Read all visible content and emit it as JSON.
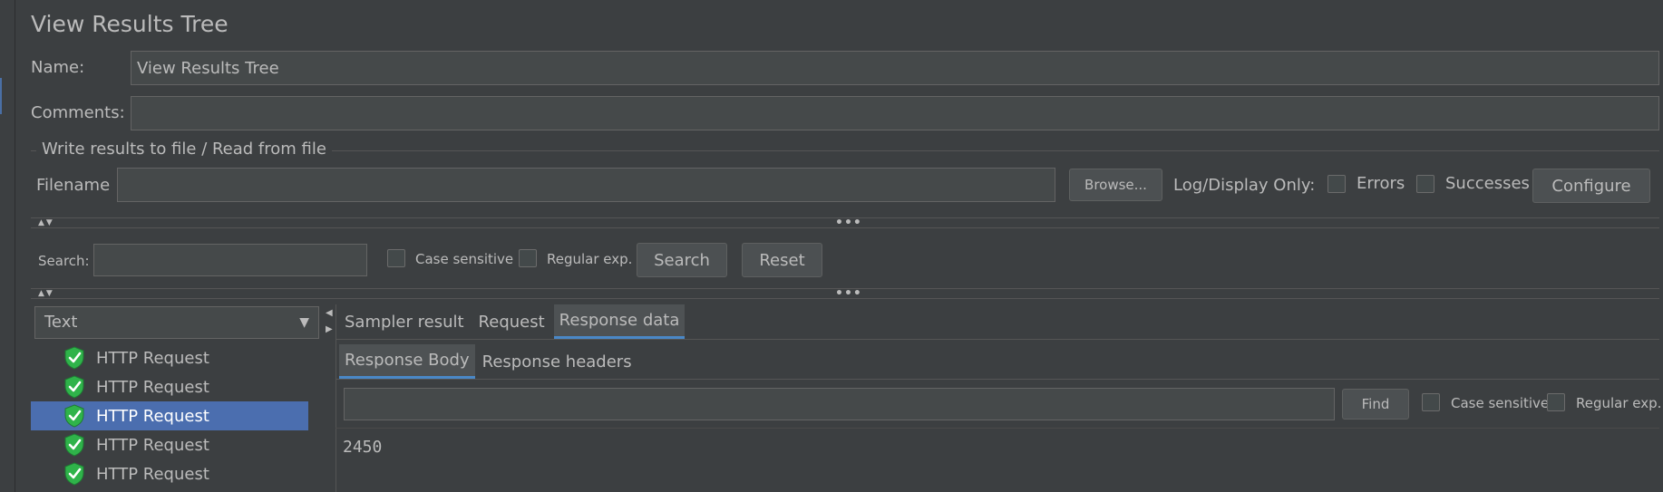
{
  "panel_title": "View Results Tree",
  "name_label": "Name:",
  "name_value": "View Results Tree",
  "comments_label": "Comments:",
  "comments_value": "",
  "file_section": {
    "legend": "Write results to file / Read from file",
    "filename_label": "Filename",
    "filename_value": "",
    "browse_label": "Browse...",
    "log_display_label": "Log/Display Only:",
    "errors_label": "Errors",
    "successes_label": "Successes",
    "configure_label": "Configure"
  },
  "search_bar": {
    "search_label": "Search:",
    "search_value": "",
    "case_sensitive_label": "Case sensitive",
    "regex_label": "Regular exp.",
    "search_button": "Search",
    "reset_button": "Reset"
  },
  "renderer_select": {
    "selected": "Text"
  },
  "tree": {
    "items": [
      {
        "label": "HTTP Request",
        "status": "success",
        "selected": false
      },
      {
        "label": "HTTP Request",
        "status": "success",
        "selected": false
      },
      {
        "label": "HTTP Request",
        "status": "success",
        "selected": true
      },
      {
        "label": "HTTP Request",
        "status": "success",
        "selected": false
      },
      {
        "label": "HTTP Request",
        "status": "success",
        "selected": false
      }
    ]
  },
  "result_tabs": [
    "Sampler result",
    "Request",
    "Response data"
  ],
  "active_result_tab": "Response data",
  "response_tabs": [
    "Response Body",
    "Response headers"
  ],
  "active_response_tab": "Response Body",
  "find_bar": {
    "find_value": "",
    "find_button": "Find",
    "case_sensitive_label": "Case sensitive",
    "regex_label": "Regular exp."
  },
  "response_body": "2450",
  "colors": {
    "background": "#3c3f41",
    "field": "#45494a",
    "selection": "#4b6eaf",
    "success_green": "#2fb34a",
    "text": "#bbbbbb"
  }
}
